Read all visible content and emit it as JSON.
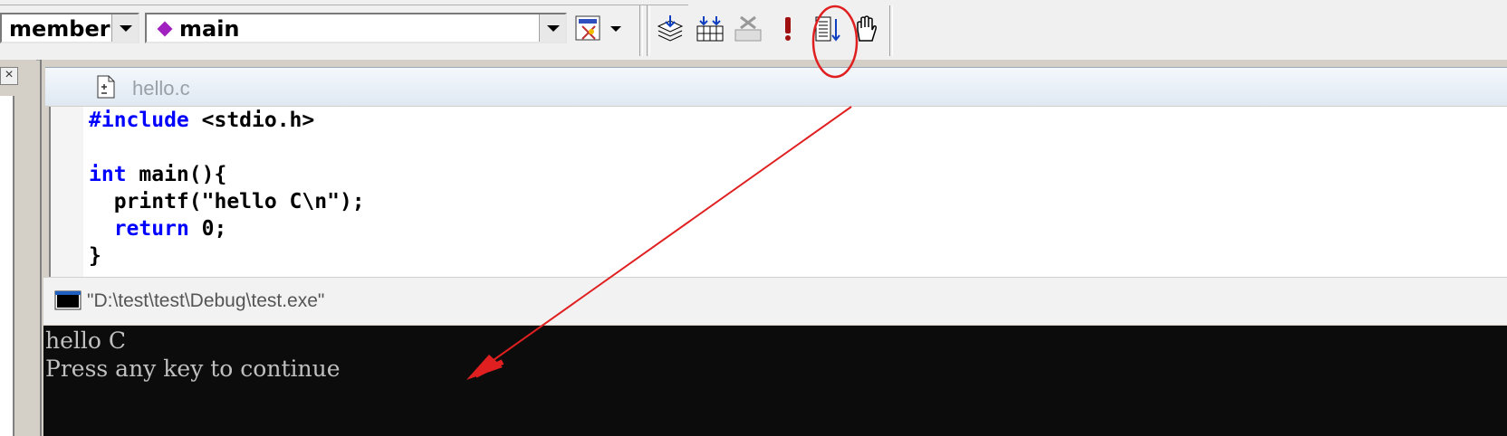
{
  "toolbar": {
    "class_combo_value": "members",
    "function_combo_value": "main",
    "icons": [
      "wizard-bar-icon",
      "compile-icon",
      "build-icon",
      "stop-build-icon",
      "execute-icon",
      "go-icon",
      "breakpoint-icon"
    ]
  },
  "document": {
    "title": "hello.c",
    "lines": {
      "l1_kw": "#include",
      "l1_rest": " <stdio.h>",
      "l3_kw": "int",
      "l3_rest": " main(){",
      "l4": "  printf(\"hello C\\n\");",
      "l5_ind": "  ",
      "l5_kw": "return",
      "l5_rest": " 0;",
      "l6": "}"
    }
  },
  "console": {
    "title": "\"D:\\test\\test\\Debug\\test.exe\"",
    "output_line1": "hello C",
    "output_line2": "Press any key to continue"
  },
  "colors": {
    "keyword": "#0000ff",
    "annotation": "#e02020",
    "console_bg": "#0c0c0c"
  }
}
